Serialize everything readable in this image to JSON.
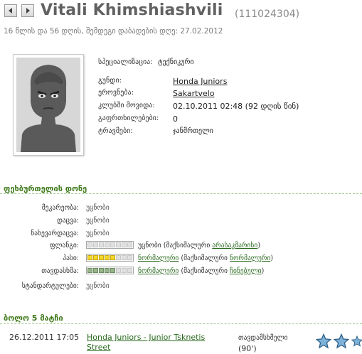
{
  "header": {
    "back_icon": "arrow-left-icon",
    "forward_icon": "arrow-right-icon",
    "player_name": "Vitali Khimshiashvili",
    "player_id": "(111024304)",
    "subtitle": "16 წლის და 56 დღის, შემდეგი დაბადების დღე: 27.02.2012"
  },
  "profile": {
    "avatar_icon": "player-silhouette-icon",
    "specialization": {
      "label": "სპეციალიზაცია:",
      "value": "ტექნიკური"
    },
    "team": {
      "label": "გუნდი:",
      "value": "Honda Juniors"
    },
    "nationality": {
      "label": "ეროვნება:",
      "value": "Sakartvelo"
    },
    "joined": {
      "label": "კლუბში მოვიდა:",
      "value": "02.10.2011 02:48 (92 დღის წინ)"
    },
    "injuries": {
      "label": "გაფრთხილებები:",
      "value": "0"
    },
    "traumas": {
      "label": "ტრავმები:",
      "value": "ჯანმრთელი"
    }
  },
  "skills": {
    "title": "ფეხბურთელის დონე",
    "rows": [
      {
        "label": "მეკარეობა:",
        "text": "უცნობი"
      },
      {
        "label": "დაცვა:",
        "text": "უცნობი"
      },
      {
        "label": "ნახევარდაცვა:",
        "text": "უცნობი"
      },
      {
        "label": "ფლანგი:",
        "text": "უცნობი",
        "max_prefix": "(მაქსიმალური",
        "max_value": "არასაკმარისი",
        "max_suffix": ")",
        "level": 0,
        "bar_color": "gray"
      },
      {
        "label": "პასი:",
        "text": "ნორმალური",
        "max_prefix": "(მაქსიმალური",
        "max_value": "ნორმალური",
        "max_suffix": ")",
        "level": 0.6,
        "bar_color": "#f3d82a"
      },
      {
        "label": "თავდასხმა:",
        "text": "ნორმალური",
        "max_prefix": "(მაქსიმალური",
        "max_value": "ჩინებული",
        "max_suffix": ")",
        "level": 0.6,
        "bar_color": "#98b48a"
      },
      {
        "label": "სტანდარტულები:",
        "text": "უცნობი"
      }
    ]
  },
  "matches": {
    "title": "ბოლო 5 მატჩი",
    "items": [
      {
        "date": "26.12.2011 17:05",
        "match": "Honda Juniors - Junior Tsknetis Street",
        "position": "თავდამსხმელი",
        "minutes": "(90')",
        "rating_stars": 3,
        "star_icon": "star-icon"
      }
    ]
  },
  "colors": {
    "link": "#2a6a1f",
    "section_title": "#3f7a1a",
    "name": "#616161"
  }
}
